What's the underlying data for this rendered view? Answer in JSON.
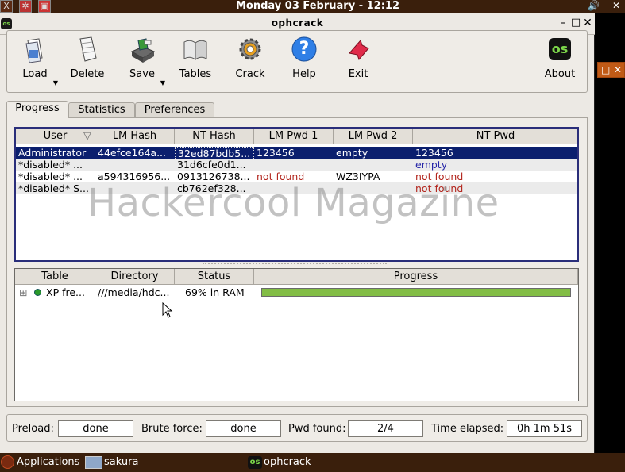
{
  "top_panel": {
    "clock": "Monday 03 February - 12:12",
    "icons": [
      "terminal-icon",
      "settings-icon",
      "app-icon"
    ],
    "tray_volume": "🔊",
    "tray_close": "✕"
  },
  "window": {
    "title": "ophcrack",
    "app_icon_text": "os",
    "minimize": "–",
    "maximize": "□",
    "close": "✕"
  },
  "toolbar": {
    "load": "Load",
    "delete": "Delete",
    "save": "Save",
    "tables": "Tables",
    "crack": "Crack",
    "help": "Help",
    "help_glyph": "?",
    "exit": "Exit",
    "about": "About",
    "about_glyph": "os"
  },
  "tabs": [
    "Progress",
    "Statistics",
    "Preferences"
  ],
  "hash_table": {
    "columns": [
      "User",
      "LM Hash",
      "NT Hash",
      "LM Pwd 1",
      "LM Pwd 2",
      "NT Pwd"
    ],
    "sort_indicator": "▽",
    "rows": [
      {
        "user": "Administrator",
        "lm_hash": "44efce164a...",
        "nt_hash": "32ed87bdb5...",
        "lm_pwd1": "123456",
        "lm_pwd2": "empty",
        "nt_pwd": "123456"
      },
      {
        "user": "*disabled* ...",
        "lm_hash": "",
        "nt_hash": "31d6cfe0d1...",
        "lm_pwd1": "",
        "lm_pwd2": "",
        "nt_pwd": "empty"
      },
      {
        "user": "*disabled* ...",
        "lm_hash": "a594316956...",
        "nt_hash": "0913126738...",
        "lm_pwd1": "not found",
        "lm_pwd2": "WZ3IYPA",
        "nt_pwd": "not found"
      },
      {
        "user": "*disabled* S...",
        "lm_hash": "",
        "nt_hash": "cb762ef328...",
        "lm_pwd1": "",
        "lm_pwd2": "",
        "nt_pwd": "not found"
      }
    ]
  },
  "tables_list": {
    "columns": [
      "Table",
      "Directory",
      "Status",
      "Progress"
    ],
    "rows": [
      {
        "expander": "⊞",
        "table": "XP fre...",
        "directory": "///media/hdc...",
        "status": "69% in RAM",
        "progress": 1.0
      }
    ]
  },
  "status_bar": {
    "preload_label": "Preload:",
    "preload_value": "done",
    "brute_label": "Brute force:",
    "brute_value": "done",
    "pwd_label": "Pwd found:",
    "pwd_value": "2/4",
    "time_label": "Time elapsed:",
    "time_value": "0h 1m 51s"
  },
  "watermark": "Hackercool Magazine",
  "side_mini": {
    "maximize": "□",
    "close": "✕"
  },
  "taskbar": {
    "applications": "Applications",
    "workspace": "sakura",
    "task": "ophcrack",
    "task_icon_text": "os"
  },
  "colors": {
    "selection": "#0b1f6e",
    "progress_fill": "#82bd45",
    "not_found": "#b3261e",
    "empty_blue": "#2626a8",
    "panel": "#3a1f0c"
  }
}
